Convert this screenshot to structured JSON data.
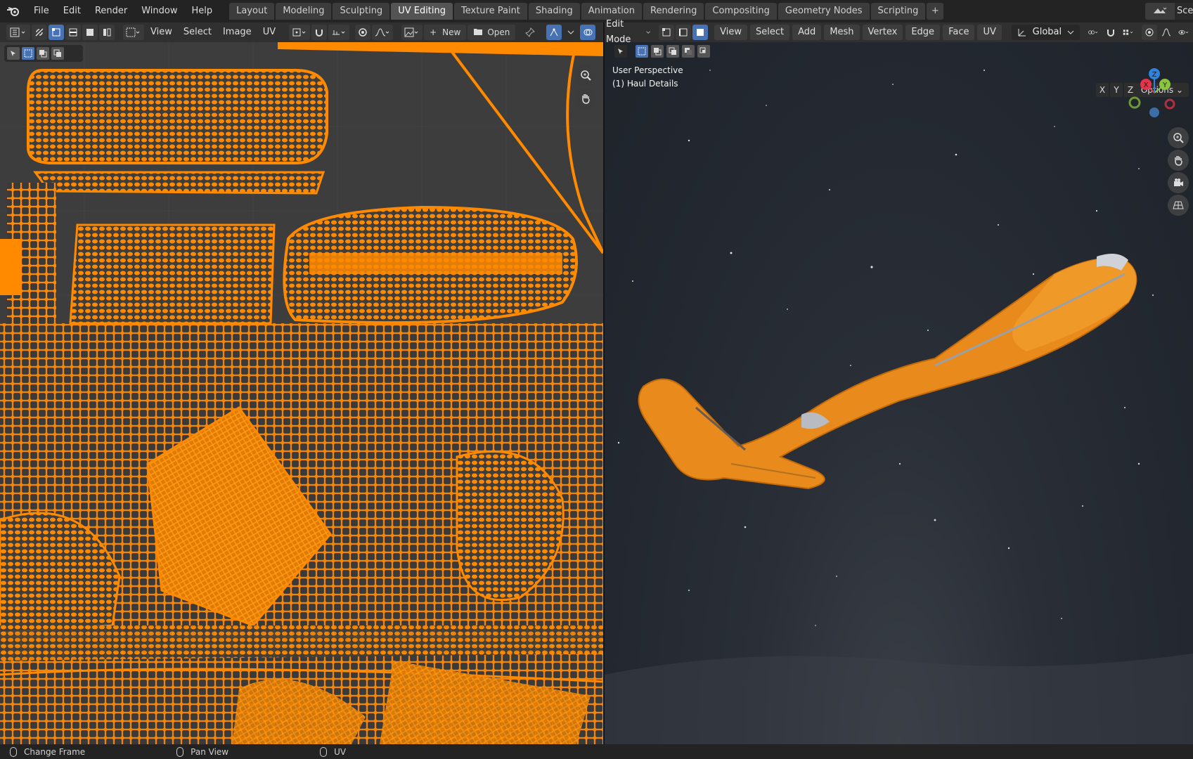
{
  "app": {
    "menu": [
      "File",
      "Edit",
      "Render",
      "Window",
      "Help"
    ],
    "workspaces": [
      "Layout",
      "Modeling",
      "Sculpting",
      "UV Editing",
      "Texture Paint",
      "Shading",
      "Animation",
      "Rendering",
      "Compositing",
      "Geometry Nodes",
      "Scripting"
    ],
    "active_workspace": "UV Editing",
    "scene_label": "Scen"
  },
  "uv_header": {
    "menus": [
      "View",
      "Select",
      "Image",
      "UV"
    ],
    "new_label": "New",
    "open_label": "Open"
  },
  "viewport_header": {
    "mode": "Edit Mode",
    "menus": [
      "View",
      "Select",
      "Add",
      "Mesh",
      "Vertex",
      "Edge",
      "Face",
      "UV"
    ],
    "orientation": "Global"
  },
  "viewport": {
    "view_name": "User Perspective",
    "object_label": "(1) Haul Details",
    "axes": [
      "X",
      "Y",
      "Z"
    ],
    "options_label": "Options",
    "gizmo": {
      "x": "X",
      "y": "Y",
      "z": "Z"
    }
  },
  "status": {
    "items": [
      "Change Frame",
      "Pan View",
      "UV"
    ]
  },
  "colors": {
    "uv_orange": "#ff8a00",
    "accent_blue": "#4772b3",
    "gizmo_x": "#e2344c",
    "gizmo_y": "#8bc53f",
    "gizmo_z": "#2f83e0"
  }
}
